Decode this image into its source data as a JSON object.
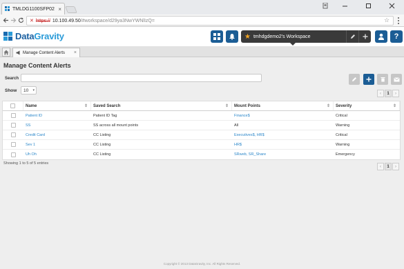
{
  "browser": {
    "tab_title": "TMLDG1100SFP02 - ...",
    "tab_close": "×",
    "url": {
      "scheme": "https://",
      "host": "10.100.49.50",
      "path": "/#workspace/d29ya3NwYWNlIzQ="
    }
  },
  "header": {
    "logo_text_a": "Data",
    "logo_text_b": "Gravity",
    "workspace_label": "tmhdgdemo2's Workspace"
  },
  "app_tabs": [
    {
      "label": "Manage Content Alerts",
      "close": "×"
    }
  ],
  "page": {
    "title": "Manage Content Alerts",
    "search_label": "Search",
    "search_value": "",
    "show_label": "Show",
    "page_size": "10",
    "current_page": "1",
    "entries_info": "Showing 1 to 5 of 5 entries",
    "copyright": "Copyright © 2013 DataGravity, Inc. All Rights Reserved."
  },
  "table": {
    "columns": [
      "Name",
      "Saved Search",
      "Mount Points",
      "Severity"
    ],
    "rows": [
      {
        "name": "Patient ID",
        "search": "Patient ID Tag",
        "mount": "Finance$",
        "severity": "Critical"
      },
      {
        "name": "SS",
        "search": "SS across all mount points",
        "mount": "All",
        "severity": "Warning"
      },
      {
        "name": "Credit Card",
        "search": "CC Listing",
        "mount": "Executives$, HR$",
        "severity": "Critical"
      },
      {
        "name": "Sev 1",
        "search": "CC Listing",
        "mount": "HR$",
        "severity": "Warning"
      },
      {
        "name": "Uh Oh",
        "search": "CC Listing",
        "mount": "SRweb, SR_Share",
        "severity": "Emergency"
      }
    ]
  },
  "colors": {
    "brand_blue": "#1b5d95",
    "link_blue": "#2a86c9",
    "workspace_bar": "#3a3a3a",
    "star": "#f5a623"
  }
}
